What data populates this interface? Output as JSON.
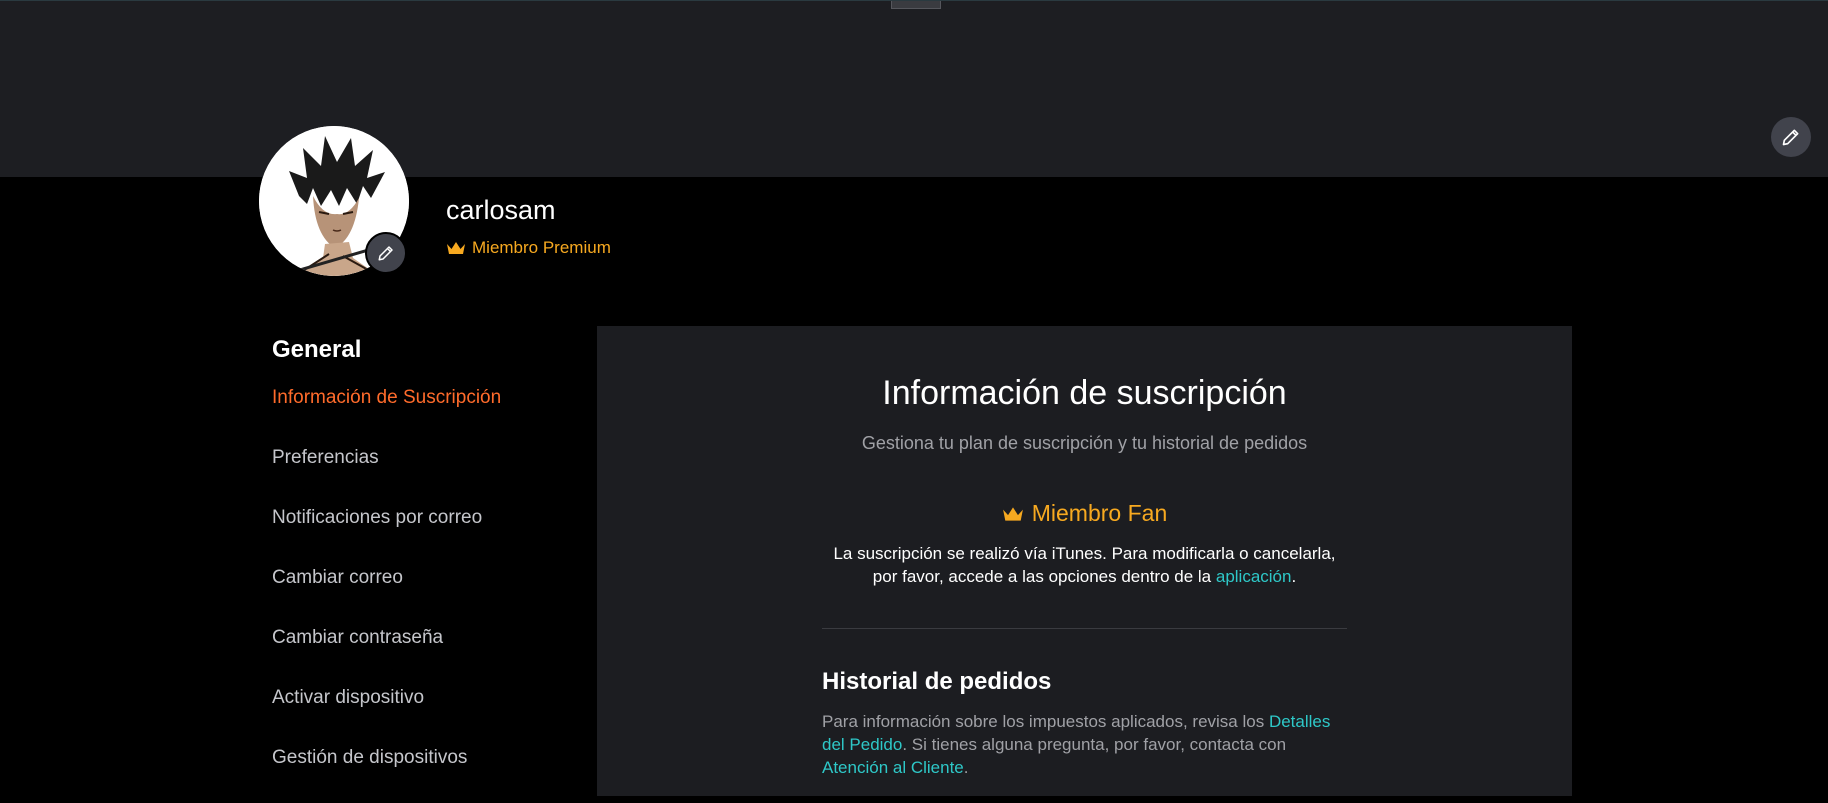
{
  "profile": {
    "username": "carlosam",
    "membership_badge": "Miembro Premium",
    "crown_icon": "crown-icon",
    "edit_icon": "pencil-icon",
    "accent_color": "#f7a920"
  },
  "sidebar": {
    "title": "General",
    "items": [
      {
        "label": "Información de Suscripción",
        "active": true
      },
      {
        "label": "Preferencias"
      },
      {
        "label": "Notificaciones por correo"
      },
      {
        "label": "Cambiar correo"
      },
      {
        "label": "Cambiar contraseña"
      },
      {
        "label": "Activar dispositivo"
      },
      {
        "label": "Gestión de dispositivos"
      }
    ],
    "active_color": "#ff6b2b"
  },
  "subscription": {
    "title": "Información de suscripción",
    "subtitle": "Gestiona tu plan de suscripción y tu historial de pedidos",
    "plan_name": "Miembro Fan",
    "desc_line1": "La suscripción se realizó vía iTunes. Para modificarla o cancelarla,",
    "desc_line2_prefix": "por favor, accede a las opciones dentro de la ",
    "desc_link": "aplicación",
    "desc_suffix": "."
  },
  "orders": {
    "title": "Historial de pedidos",
    "text_prefix": "Para información sobre los impuestos aplicados, revisa los ",
    "details_link": "Detalles del Pedido",
    "text_middle": ". Si tienes alguna pregunta, por favor, contacta con ",
    "support_link": "Atención al Cliente",
    "text_suffix": ".",
    "link_color": "#2ec8c8"
  }
}
